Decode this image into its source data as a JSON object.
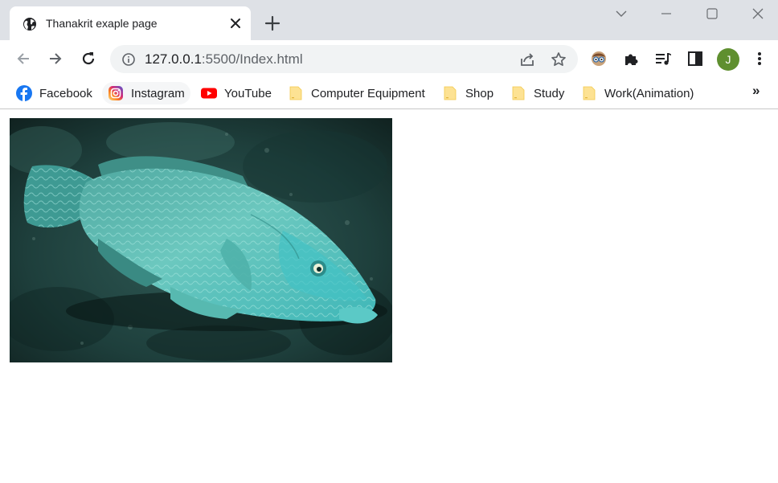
{
  "tab": {
    "title": "Thanakrit exaple page",
    "favicon": "globe-icon"
  },
  "window_controls": [
    "tab-search-icon",
    "minimize-icon",
    "maximize-icon",
    "close-icon"
  ],
  "address_bar": {
    "host": "127.0.0.1",
    "rest": ":5500/Index.html"
  },
  "profile": {
    "initial": "J",
    "color": "#5f8f2f"
  },
  "bookmarks": [
    {
      "label": "Facebook",
      "icon": "facebook-icon"
    },
    {
      "label": "Instagram",
      "icon": "instagram-icon"
    },
    {
      "label": "YouTube",
      "icon": "youtube-icon"
    },
    {
      "label": "Computer Equipment",
      "icon": "folder-icon"
    },
    {
      "label": "Shop",
      "icon": "folder-icon"
    },
    {
      "label": "Study",
      "icon": "folder-icon"
    },
    {
      "label": "Work(Animation)",
      "icon": "folder-icon"
    }
  ],
  "bookmarks_overflow": "»",
  "page": {
    "image": "humphead-wrasse-fish-photo"
  }
}
